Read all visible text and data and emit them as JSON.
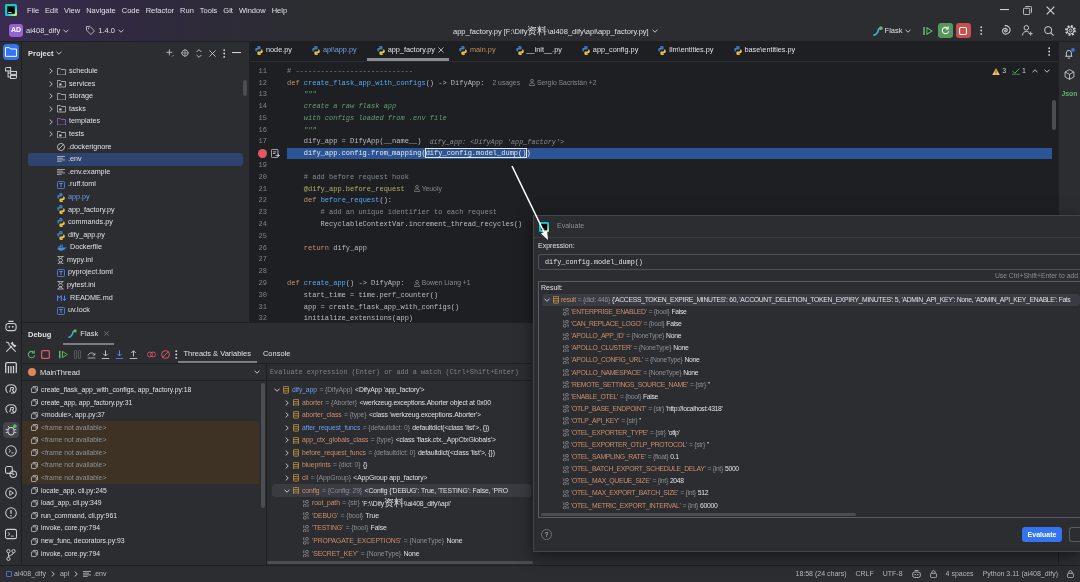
{
  "title_bar": {
    "menu": [
      "File",
      "Edit",
      "View",
      "Navigate",
      "Code",
      "Refactor",
      "Run",
      "Tools",
      "Git",
      "Window",
      "Help"
    ]
  },
  "main_toolbar": {
    "project_badge": "AD",
    "project": "ai408_dify",
    "version": "1.4.0",
    "file_title": "app_factory.py [F:\\Dify资料\\ai408_dify\\api\\app_factory.py]",
    "run_config": "Flask"
  },
  "tool_strip": {
    "top": [
      {
        "selected": true
      },
      {
        "selected": false
      }
    ],
    "bottom": [
      {
        "selected": false
      },
      {
        "selected": false
      },
      {
        "selected": false
      },
      {
        "selected": false
      },
      {
        "selected": false
      },
      {
        "selected": true
      },
      {
        "selected": false
      },
      {
        "selected": false
      },
      {
        "selected": false
      },
      {
        "selected": false
      },
      {
        "selected": false
      },
      {
        "selected": false
      }
    ]
  },
  "project_panel": {
    "title": "Project",
    "items": [
      {
        "label": "schedule",
        "kind": "folder",
        "expanded": false,
        "selected": false,
        "modified": false
      },
      {
        "label": "services",
        "kind": "package",
        "expanded": false,
        "selected": false,
        "modified": false
      },
      {
        "label": "storage",
        "kind": "folder",
        "expanded": false,
        "selected": false,
        "modified": false
      },
      {
        "label": "tasks",
        "kind": "package",
        "expanded": false,
        "selected": false,
        "modified": false
      },
      {
        "label": "templates",
        "kind": "resource-folder",
        "expanded": false,
        "selected": false,
        "modified": false
      },
      {
        "label": "tests",
        "kind": "package",
        "expanded": false,
        "selected": false,
        "modified": false
      },
      {
        "label": ".dockerignore",
        "kind": "ignore-file",
        "selected": false,
        "modified": false
      },
      {
        "label": ".env",
        "kind": "text-file",
        "selected": true,
        "modified": false
      },
      {
        "label": ".env.example",
        "kind": "text-file",
        "selected": false,
        "modified": false
      },
      {
        "label": ".ruff.toml",
        "kind": "toml-file",
        "selected": false,
        "modified": false
      },
      {
        "label": "app.py",
        "kind": "python-file",
        "selected": false,
        "modified": true
      },
      {
        "label": "app_factory.py",
        "kind": "python-file",
        "selected": false,
        "modified": false
      },
      {
        "label": "commands.py",
        "kind": "python-file",
        "selected": false,
        "modified": false
      },
      {
        "label": "dify_app.py",
        "kind": "python-file",
        "selected": false,
        "modified": false
      },
      {
        "label": "Dockerfile",
        "kind": "docker-file",
        "selected": false,
        "modified": false
      },
      {
        "label": "mypy.ini",
        "kind": "ini-file",
        "selected": false,
        "modified": false
      },
      {
        "label": "pyproject.toml",
        "kind": "toml-file",
        "selected": false,
        "modified": false
      },
      {
        "label": "pytest.ini",
        "kind": "ini-file",
        "selected": false,
        "modified": false
      },
      {
        "label": "README.md",
        "kind": "markdown-file",
        "selected": false,
        "modified": false
      },
      {
        "label": "uv.lock",
        "kind": "toml-file",
        "selected": false,
        "modified": false
      }
    ]
  },
  "editor": {
    "tabs": [
      {
        "label": "node.py",
        "selected": false,
        "modified": false,
        "unversioned": false
      },
      {
        "label": "api\\app.py",
        "selected": false,
        "modified": true,
        "unversioned": false
      },
      {
        "label": "app_factory.py",
        "selected": true,
        "modified": false,
        "unversioned": false
      },
      {
        "label": "main.py",
        "selected": false,
        "modified": false,
        "unversioned": true
      },
      {
        "label": "__init__.py",
        "selected": false,
        "modified": false,
        "unversioned": false
      },
      {
        "label": "app_config.py",
        "selected": false,
        "modified": false,
        "unversioned": false
      },
      {
        "label": "llm\\entities.py",
        "selected": false,
        "modified": false,
        "unversioned": false
      },
      {
        "label": "base\\entities.py",
        "selected": false,
        "modified": false,
        "unversioned": false
      }
    ],
    "inspections": {
      "warnings": "3",
      "checks": "1"
    },
    "lines": [
      {
        "number": "11",
        "breakpoint": false,
        "current": false,
        "tokens": [
          {
            "kind": "comment",
            "text": "# ----------------------------"
          }
        ]
      },
      {
        "number": "12",
        "breakpoint": false,
        "current": false,
        "tokens": [
          {
            "kind": "keyword",
            "text": "def "
          },
          {
            "kind": "function",
            "text": "create_flask_app_with_configs"
          },
          {
            "kind": "plain",
            "text": "() -> DifyApp:"
          }
        ],
        "hints": [
          {
            "kind": "usages",
            "text": "2 usages"
          },
          {
            "kind": "author",
            "text": "Sergio Sacristán +2"
          }
        ]
      },
      {
        "number": "13",
        "breakpoint": false,
        "current": false,
        "tokens": [
          {
            "kind": "docstring",
            "text": "    \"\"\""
          }
        ]
      },
      {
        "number": "14",
        "breakpoint": false,
        "current": false,
        "tokens": [
          {
            "kind": "docstring",
            "text": "    create a raw flask app"
          }
        ]
      },
      {
        "number": "15",
        "breakpoint": false,
        "current": false,
        "tokens": [
          {
            "kind": "docstring",
            "text": "    with configs loaded from .env file"
          }
        ]
      },
      {
        "number": "16",
        "breakpoint": false,
        "current": false,
        "tokens": [
          {
            "kind": "docstring",
            "text": "    \"\"\""
          }
        ]
      },
      {
        "number": "17",
        "breakpoint": false,
        "current": false,
        "tokens": [
          {
            "kind": "plain",
            "text": "    dify_app = DifyApp(__name__)"
          }
        ],
        "hints": [
          {
            "kind": "debug_value",
            "text": "dify_app: <DifyApp 'app_factory'>"
          }
        ]
      },
      {
        "breakpoint": true,
        "current": true,
        "tokens": [
          {
            "kind": "plain",
            "text": "    dify_app.config.from_mapping("
          },
          {
            "kind": "selection",
            "text": "dify_config.model_dump()"
          },
          {
            "kind": "plain",
            "text": ")"
          }
        ]
      },
      {
        "number": "19",
        "breakpoint": false,
        "current": false
      },
      {
        "number": "20",
        "breakpoint": false,
        "current": false,
        "tokens": [
          {
            "kind": "comment",
            "text": "    # add before request hook"
          }
        ]
      },
      {
        "number": "21",
        "breakpoint": false,
        "current": false,
        "tokens": [
          {
            "kind": "decorator",
            "text": "    @dify_app.before_request"
          }
        ],
        "hints": [
          {
            "kind": "author",
            "text": "Yeuoly"
          }
        ]
      },
      {
        "number": "22",
        "breakpoint": false,
        "current": false,
        "tokens": [
          {
            "kind": "keyword",
            "text": "    def "
          },
          {
            "kind": "function",
            "text": "before_request"
          },
          {
            "kind": "plain",
            "text": "():"
          }
        ]
      },
      {
        "number": "23",
        "breakpoint": false,
        "current": false,
        "tokens": [
          {
            "kind": "comment",
            "text": "        # add an unique identifier to each request"
          }
        ]
      },
      {
        "number": "24",
        "breakpoint": false,
        "current": false,
        "tokens": [
          {
            "kind": "plain",
            "text": "        RecyclableContextVar.increment_thread_recycles()"
          }
        ]
      },
      {
        "number": "25",
        "breakpoint": false,
        "current": false
      },
      {
        "number": "26",
        "breakpoint": false,
        "current": false,
        "tokens": [
          {
            "kind": "keyword",
            "text": "    return"
          },
          {
            "kind": "plain",
            "text": " dify_app"
          }
        ]
      },
      {
        "number": "27",
        "breakpoint": false,
        "current": false
      },
      {
        "number": "28",
        "breakpoint": false,
        "current": false
      },
      {
        "number": "29",
        "breakpoint": false,
        "current": false,
        "tokens": [
          {
            "kind": "keyword",
            "text": "def "
          },
          {
            "kind": "function",
            "text": "create_app"
          },
          {
            "kind": "plain",
            "text": "() -> DifyApp:"
          }
        ],
        "hints": [
          {
            "kind": "author",
            "text": "Bowen Liang +1"
          }
        ]
      },
      {
        "number": "30",
        "breakpoint": false,
        "current": false,
        "tokens": [
          {
            "kind": "plain",
            "text": "    start_time = time.perf_counter()"
          }
        ]
      },
      {
        "number": "31",
        "breakpoint": false,
        "current": false,
        "tokens": [
          {
            "kind": "plain",
            "text": "    app = create_flask_app_with_configs()"
          }
        ]
      },
      {
        "number": "32",
        "breakpoint": false,
        "current": false,
        "tokens": [
          {
            "kind": "plain",
            "text": "    initialize_extensions(app)"
          }
        ]
      }
    ]
  },
  "right_strip": {
    "label": "Json"
  },
  "debug_panel": {
    "title": "Debug",
    "session_tabs": [
      {
        "label": "Flask",
        "selected": true
      }
    ],
    "view_tabs": [
      {
        "label": "Threads & Variables",
        "selected": true
      },
      {
        "label": "Console",
        "selected": false
      }
    ],
    "thread": "MainThread",
    "frames": [
      {
        "label": "create_flask_app_with_configs, app_factory.py:18",
        "available": true
      },
      {
        "label": "create_app, app_factory.py:31",
        "available": true
      },
      {
        "label": "<module>, app.py:37",
        "available": true
      },
      {
        "label": "<frame not available>",
        "available": false
      },
      {
        "label": "<frame not available>",
        "available": false
      },
      {
        "label": "<frame not available>",
        "available": false
      },
      {
        "label": "<frame not available>",
        "available": false
      },
      {
        "label": "<frame not available>",
        "available": false
      },
      {
        "label": "locate_app, cli.py:245",
        "available": true
      },
      {
        "label": "load_app, cli.py:349",
        "available": true
      },
      {
        "label": "run_command, cli.py:961",
        "available": true
      },
      {
        "label": "invoke, core.py:794",
        "available": true
      },
      {
        "label": "new_func, decorators.py:93",
        "available": true
      },
      {
        "label": "invoke, core.py:794",
        "available": true
      }
    ],
    "watch_placeholder": "Evaluate expression (Enter) or add a watch (Ctrl+Shift+Enter)",
    "variables": [
      {
        "name": "dify_app",
        "type": "= {DifyApp}",
        "value": "<DifyApp 'app_factory'>",
        "kind": "object",
        "expanded": true,
        "selected": false,
        "changed": true,
        "children": [
          {
            "name": "aborter",
            "type": "= {Aborter}",
            "value": "<werkzeug.exceptions.Aborter object at 0x00",
            "kind": "object",
            "expanded": false,
            "selected": false,
            "changed": false
          },
          {
            "name": "aborter_class",
            "type": "= {type}",
            "value": "<class 'werkzeug.exceptions.Aborter'>",
            "kind": "object",
            "expanded": false,
            "selected": false,
            "changed": false
          },
          {
            "name": "after_request_funcs",
            "type": "= {defaultdict: 0}",
            "value": "defaultdict(<class 'list'>, {})",
            "kind": "object",
            "expanded": false,
            "selected": false,
            "changed": true
          },
          {
            "name": "app_ctx_globals_class",
            "type": "= {type}",
            "value": "<class 'flask.ctx._AppCtxGlobals'>",
            "kind": "object",
            "expanded": false,
            "selected": false,
            "changed": false
          },
          {
            "name": "before_request_funcs",
            "type": "= {defaultdict: 0}",
            "value": "defaultdict(<class 'list'>, {})",
            "kind": "object",
            "expanded": false,
            "selected": false,
            "changed": false
          },
          {
            "name": "blueprints",
            "type": "= {dict: 0}",
            "value": "{}",
            "kind": "object",
            "expanded": false,
            "selected": false,
            "changed": false
          },
          {
            "name": "cli",
            "type": "= {AppGroup}",
            "value": "<AppGroup app_factory>",
            "kind": "object",
            "expanded": false,
            "selected": false,
            "changed": false
          },
          {
            "name": "config",
            "type": "= {Config: 29}",
            "value": "<Config {'DEBUG': True, 'TESTING': False, 'PRO",
            "kind": "object",
            "expanded": true,
            "selected": true,
            "changed": false,
            "children": [
              {
                "name": "root_path",
                "type": "= {str}",
                "value": "'F:\\\\Dify资料\\\\ai408_dify\\\\api'",
                "kind": "primitive",
                "selected": false,
                "changed": false
              },
              {
                "name": "'DEBUG'",
                "type": "= {bool}",
                "value": "True",
                "kind": "primitive",
                "selected": false,
                "changed": false
              },
              {
                "name": "'TESTING'",
                "type": "= {bool}",
                "value": "False",
                "kind": "primitive",
                "selected": false,
                "changed": false
              },
              {
                "name": "'PROPAGATE_EXCEPTIONS'",
                "type": "= {NoneType}",
                "value": "None",
                "kind": "primitive",
                "selected": false,
                "changed": false
              },
              {
                "name": "'SECRET_KEY'",
                "type": "= {NoneType}",
                "value": "None",
                "kind": "primitive",
                "selected": false,
                "changed": false
              }
            ]
          }
        ]
      }
    ]
  },
  "evaluate_dialog": {
    "title": "Evaluate",
    "expression_label": "Expression:",
    "expression": "dify_config.model_dump()",
    "hint": "Use Ctrl+Shift+Enter to add",
    "result_label": "Result:",
    "result": [
      {
        "name": "result",
        "type": "= {dict: 446}",
        "value": "{'ACCESS_TOKEN_EXPIRE_MINUTES': 60, 'ACCOUNT_DELETION_TOKEN_EXPIRY_MINUTES': 5, 'ADMIN_API_KEY': None, 'ADMIN_API_KEY_ENABLE': Fals",
        "kind": "object",
        "expanded": true,
        "selected": true,
        "changed": false,
        "children": [
          {
            "name": "'ENTERPRISE_ENABLED'",
            "type": "= {bool}",
            "value": "False",
            "kind": "primitive",
            "selected": false,
            "changed": false
          },
          {
            "name": "'CAN_REPLACE_LOGO'",
            "type": "= {bool}",
            "value": "False",
            "kind": "primitive",
            "selected": false,
            "changed": false
          },
          {
            "name": "'APOLLO_APP_ID'",
            "type": "= {NoneType}",
            "value": "None",
            "kind": "primitive",
            "selected": false,
            "changed": false
          },
          {
            "name": "'APOLLO_CLUSTER'",
            "type": "= {NoneType}",
            "value": "None",
            "kind": "primitive",
            "selected": false,
            "changed": false
          },
          {
            "name": "'APOLLO_CONFIG_URL'",
            "type": "= {NoneType}",
            "value": "None",
            "kind": "primitive",
            "selected": false,
            "changed": false
          },
          {
            "name": "'APOLLO_NAMESPACE'",
            "type": "= {NoneType}",
            "value": "None",
            "kind": "primitive",
            "selected": false,
            "changed": false
          },
          {
            "name": "'REMOTE_SETTINGS_SOURCE_NAME'",
            "type": "= {str}",
            "value": "''",
            "kind": "primitive",
            "selected": false,
            "changed": false
          },
          {
            "name": "'ENABLE_OTEL'",
            "type": "= {bool}",
            "value": "False",
            "kind": "primitive",
            "selected": false,
            "changed": false
          },
          {
            "name": "'OTLP_BASE_ENDPOINT'",
            "type": "= {str}",
            "value": "'http://localhost:4318'",
            "kind": "primitive",
            "selected": false,
            "changed": false
          },
          {
            "name": "'OTLP_API_KEY'",
            "type": "= {str}",
            "value": "''",
            "kind": "primitive",
            "selected": false,
            "changed": false
          },
          {
            "name": "'OTEL_EXPORTER_TYPE'",
            "type": "= {str}",
            "value": "'otlp'",
            "kind": "primitive",
            "selected": false,
            "changed": false
          },
          {
            "name": "'OTEL_EXPORTER_OTLP_PROTOCOL'",
            "type": "= {str}",
            "value": "''",
            "kind": "primitive",
            "selected": false,
            "changed": false
          },
          {
            "name": "'OTEL_SAMPLING_RATE'",
            "type": "= {float}",
            "value": "0.1",
            "kind": "primitive",
            "selected": false,
            "changed": false
          },
          {
            "name": "'OTEL_BATCH_EXPORT_SCHEDULE_DELAY'",
            "type": "= {int}",
            "value": "5000",
            "kind": "primitive",
            "selected": false,
            "changed": false
          },
          {
            "name": "'OTEL_MAX_QUEUE_SIZE'",
            "type": "= {int}",
            "value": "2048",
            "kind": "primitive",
            "selected": false,
            "changed": false
          },
          {
            "name": "'OTEL_MAX_EXPORT_BATCH_SIZE'",
            "type": "= {int}",
            "value": "512",
            "kind": "primitive",
            "selected": false,
            "changed": false
          },
          {
            "name": "'OTEL_METRIC_EXPORT_INTERVAL'",
            "type": "= {int}",
            "value": "60000",
            "kind": "primitive",
            "selected": false,
            "changed": false
          }
        ]
      }
    ],
    "help": "?",
    "button": "Evaluate"
  },
  "status_bar": {
    "breadcrumb": [
      "ai408_dify",
      "api",
      ".env"
    ],
    "items": [
      "18:58 (24 chars)",
      "CRLF",
      "UTF-8",
      "4 spaces",
      "Python 3.11 (ai408_dify)"
    ]
  }
}
